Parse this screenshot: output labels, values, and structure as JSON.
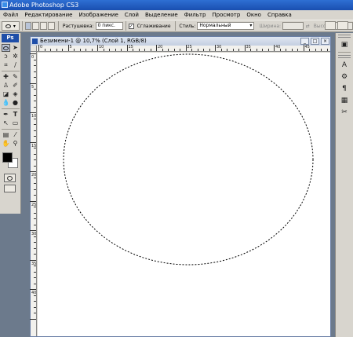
{
  "app": {
    "title": "Adobe Photoshop CS3"
  },
  "menu": [
    "Файл",
    "Редактирование",
    "Изображение",
    "Слой",
    "Выделение",
    "Фильтр",
    "Просмотр",
    "Окно",
    "Справка"
  ],
  "options": {
    "feather_label": "Растушевка:",
    "feather_value": "0 пикс.",
    "antialias_label": "Сглаживание",
    "style_label": "Стиль:",
    "style_value": "Нормальный",
    "width_label": "Ширина:",
    "height_label": "Высота:"
  },
  "toolbox": {
    "logo": "Ps",
    "tools": [
      "marquee-ellipse",
      "move",
      "lasso",
      "magic-wand",
      "crop",
      "slice",
      "healing-brush",
      "brush",
      "clone-stamp",
      "history-brush",
      "eraser",
      "paint-bucket",
      "blur",
      "dodge",
      "pen",
      "text",
      "path-selection",
      "shape",
      "notes",
      "eyedropper",
      "hand",
      "zoom"
    ],
    "text_tool_glyph": "T",
    "foreground_color": "#000000",
    "background_color": "#ffffff"
  },
  "document": {
    "title": "Безимени-1 @ 10,7% (Слой 1, RGB/8)",
    "ruler_h_labels": [
      "0",
      "5",
      "10",
      "15",
      "20",
      "25",
      "30",
      "35",
      "40",
      "45"
    ],
    "ruler_v_labels": [
      "0",
      "5",
      "10",
      "15",
      "20",
      "25",
      "30",
      "35",
      "40"
    ]
  },
  "dock": {
    "icons": [
      "navigator-icon",
      "character-icon",
      "layer-comps-icon",
      "paragraph-icon",
      "clone-source-icon",
      "tool-presets-icon"
    ],
    "character_glyph": "A",
    "paragraph_glyph": "¶"
  }
}
